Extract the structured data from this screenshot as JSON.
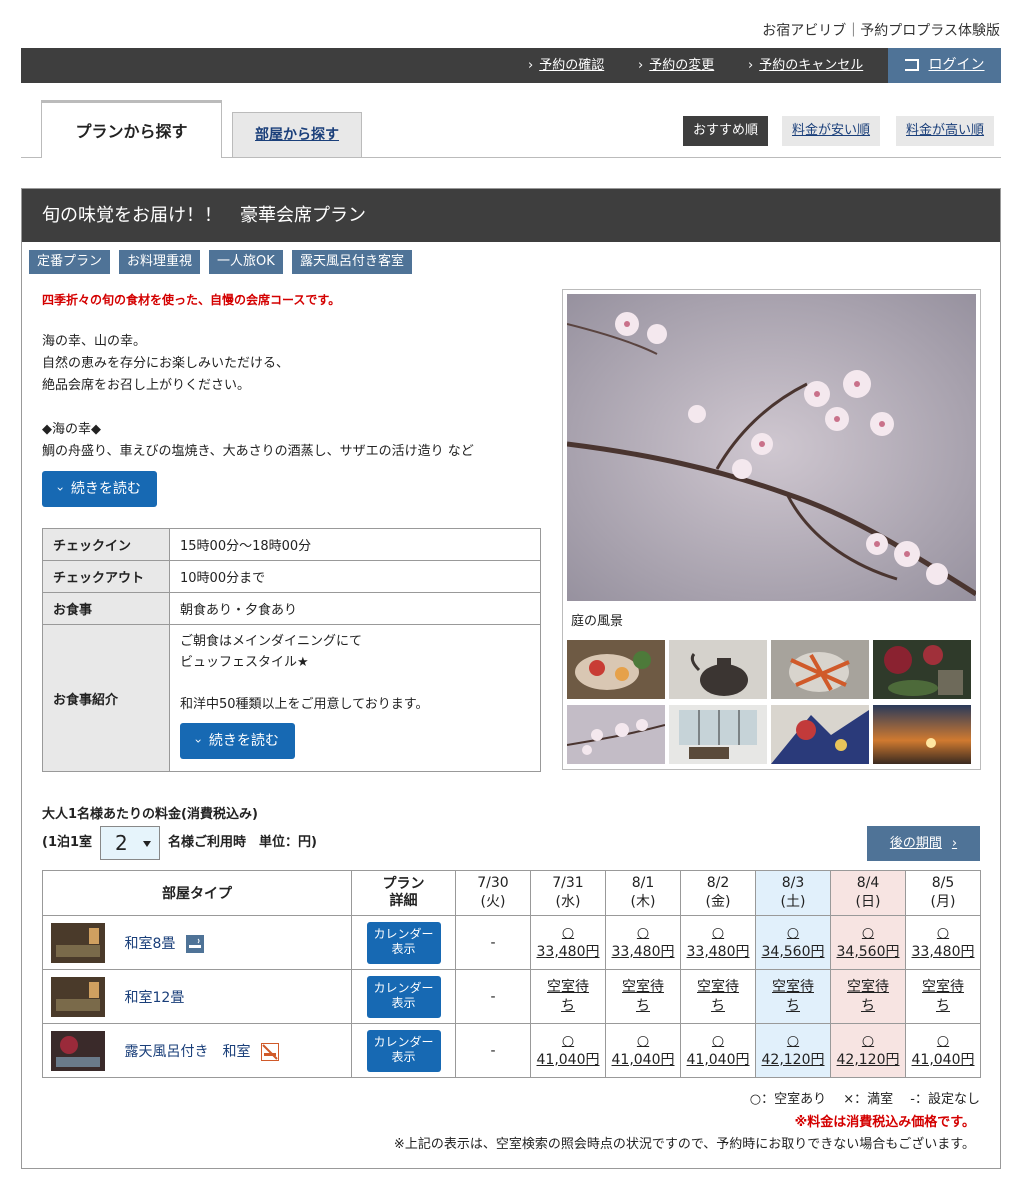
{
  "site": {
    "title": "お宿アビリブ｜予約プロプラス体験版"
  },
  "topnav": {
    "items": [
      "予約の確認",
      "予約の変更",
      "予約のキャンセル"
    ],
    "login": "ログイン"
  },
  "tabs": {
    "plan": "プランから探す",
    "room": "部屋から探す"
  },
  "sort": {
    "recommend": "おすすめ順",
    "low": "料金が安い順",
    "high": "料金が高い順"
  },
  "plan": {
    "title": "旬の味覚をお届け！！　豪華会席プラン",
    "badges": [
      "定番プラン",
      "お料理重視",
      "一人旅OK",
      "露天風呂付き客室"
    ],
    "lead": "四季折々の旬の食材を使った、自慢の会席コースです。",
    "description": "海の幸、山の幸。\n自然の恵みを存分にお楽しみいただける、\n絶品会席をお召し上がりください。\n\n◆海の幸◆\n鯛の舟盛り、車えびの塩焼き、大あさりの酒蒸し、サザエの活け造り など",
    "read_more": "続きを読む",
    "info": {
      "checkin_label": "チェックイン",
      "checkin_value": "15時00分～18時00分",
      "checkout_label": "チェックアウト",
      "checkout_value": "10時00分まで",
      "meal_label": "お食事",
      "meal_value": "朝食あり・夕食あり",
      "meal_intro_label": "お食事紹介",
      "meal_intro_value": "ご朝食はメインダイニングにて\nビュッフェスタイル★\n\n和洋中50種類以上をご用意しております。",
      "read_more": "続きを読む"
    },
    "photo_caption": "庭の風景"
  },
  "pricing": {
    "title": "大人1名様あたりの料金(消費税込み)",
    "per_room": "(1泊1室",
    "people": "2",
    "people_suffix": "名様ご利用時　単位：円)",
    "next": "後の期間",
    "head_room": "部屋タイプ",
    "head_plan": "プラン\n詳細",
    "dates": [
      {
        "d": "7/30",
        "w": "(火)"
      },
      {
        "d": "7/31",
        "w": "(水)"
      },
      {
        "d": "8/1",
        "w": "(木)"
      },
      {
        "d": "8/2",
        "w": "(金)"
      },
      {
        "d": "8/3",
        "w": "(土)"
      },
      {
        "d": "8/4",
        "w": "(日)"
      },
      {
        "d": "8/5",
        "w": "(月)"
      }
    ],
    "calendar_btn": "カレンダー\n表示",
    "rooms": [
      {
        "name": "和室8畳",
        "cells": [
          "-",
          "○\n33,480円",
          "○\n33,480円",
          "○\n33,480円",
          "○\n34,560円",
          "○\n34,560円",
          "○\n33,480円"
        ]
      },
      {
        "name": "和室12畳",
        "cells": [
          "-",
          "空室待\nち",
          "空室待\nち",
          "空室待\nち",
          "空室待\nち",
          "空室待\nち",
          "空室待\nち"
        ]
      },
      {
        "name": "露天風呂付き　和室",
        "cells": [
          "-",
          "○\n41,040円",
          "○\n41,040円",
          "○\n41,040円",
          "○\n42,120円",
          "○\n42,120円",
          "○\n41,040円"
        ]
      }
    ],
    "legend": "○：空室あり　 ×：満室　 -：設定なし",
    "note_red": "※料金は消費税込み価格です。",
    "note": "※上記の表示は、空室検索の照会時点の状況ですので、予約時にお取りできない場合もございます。"
  }
}
